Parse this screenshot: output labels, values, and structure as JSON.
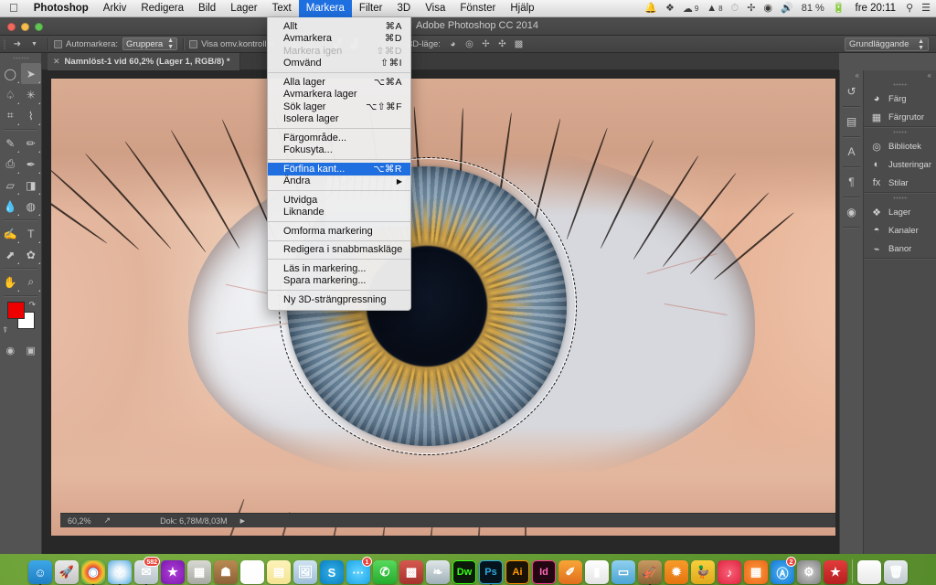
{
  "menubar": {
    "apple_icon": "apple-logo",
    "items": [
      {
        "label": "Photoshop",
        "bold": true,
        "active": false
      },
      {
        "label": "Arkiv",
        "bold": false,
        "active": false
      },
      {
        "label": "Redigera",
        "bold": false,
        "active": false
      },
      {
        "label": "Bild",
        "bold": false,
        "active": false
      },
      {
        "label": "Lager",
        "bold": false,
        "active": false
      },
      {
        "label": "Text",
        "bold": false,
        "active": false
      },
      {
        "label": "Markera",
        "bold": false,
        "active": true
      },
      {
        "label": "Filter",
        "bold": false,
        "active": false
      },
      {
        "label": "3D",
        "bold": false,
        "active": false
      },
      {
        "label": "Visa",
        "bold": false,
        "active": false
      },
      {
        "label": "Fönster",
        "bold": false,
        "active": false
      },
      {
        "label": "Hjälp",
        "bold": false,
        "active": false
      }
    ],
    "status": {
      "bell_icon": "bell-icon",
      "dropbox_icon": "dropbox-icon",
      "cc_icon": "creative-cloud-icon",
      "cc_badge": "9",
      "adobe_icon": "adobe-icon",
      "adobe_badge": "8",
      "clock_icon": "time-machine-icon",
      "vpn_icon": "vpn-icon",
      "wifi_icon": "wifi-icon",
      "volume_icon": "volume-icon",
      "battery_percent": "81 %",
      "battery_icon": "battery-icon",
      "clock": "fre 20:11",
      "search_icon": "spotlight-search-icon",
      "notification_icon": "notification-center-icon"
    }
  },
  "app": {
    "title": "Adobe Photoshop CC 2014",
    "window_controls": {
      "close": "close",
      "minimize": "minimize",
      "zoom": "zoom"
    }
  },
  "options_bar": {
    "move_tool_icon": "move-tool-icon",
    "preset_arrow": "chevron-down-icon",
    "auto_select_label": "Automarkera:",
    "auto_select_value": "Gruppera",
    "show_controls_label": "Visa omv.kontroller",
    "align_icons": [
      "align-left-edges",
      "align-horizontal-centers",
      "align-right-edges",
      "align-top-edges",
      "align-vertical-centers",
      "align-bottom-edges",
      "distribute-icon"
    ],
    "mode3d_label": "3D-läge:",
    "mode3d_icons": [
      "orbit-3d-icon",
      "roll-3d-icon",
      "pan-3d-icon",
      "slide-3d-icon",
      "zoom-3d-icon"
    ],
    "workspace": "Grundläggande"
  },
  "toolbox": {
    "tools": [
      {
        "row": [
          {
            "name": "elliptical-marquee-tool",
            "glyph": "◯",
            "selected": false
          },
          {
            "name": "move-tool",
            "glyph": "➤",
            "selected": true
          }
        ]
      },
      {
        "row": [
          {
            "name": "lasso-tool",
            "glyph": "♤",
            "selected": false
          },
          {
            "name": "magic-wand-tool",
            "glyph": "✳",
            "selected": false
          }
        ]
      },
      {
        "row": [
          {
            "name": "crop-tool",
            "glyph": "⌗",
            "selected": false
          },
          {
            "name": "eyedropper-tool",
            "glyph": "⌇",
            "selected": false
          }
        ]
      },
      {
        "row": [
          {
            "name": "spot-healing-brush-tool",
            "glyph": "✎",
            "selected": false
          },
          {
            "name": "brush-tool",
            "glyph": "✏",
            "selected": false
          }
        ]
      },
      {
        "row": [
          {
            "name": "clone-stamp-tool",
            "glyph": "⎙",
            "selected": false
          },
          {
            "name": "history-brush-tool",
            "glyph": "✒",
            "selected": false
          }
        ]
      },
      {
        "row": [
          {
            "name": "eraser-tool",
            "glyph": "▱",
            "selected": false
          },
          {
            "name": "gradient-tool",
            "glyph": "◨",
            "selected": false
          }
        ]
      },
      {
        "row": [
          {
            "name": "blur-tool",
            "glyph": "💧",
            "selected": false
          },
          {
            "name": "dodge-tool",
            "glyph": "◍",
            "selected": false
          }
        ]
      },
      {
        "row": [
          {
            "name": "pen-tool",
            "glyph": "✍",
            "selected": false
          },
          {
            "name": "type-tool",
            "glyph": "T",
            "selected": false
          }
        ]
      },
      {
        "row": [
          {
            "name": "path-selection-tool",
            "glyph": "⬈",
            "selected": false
          },
          {
            "name": "custom-shape-tool",
            "glyph": "✿",
            "selected": false
          }
        ]
      },
      {
        "row": [
          {
            "name": "hand-tool",
            "glyph": "✋",
            "selected": false
          },
          {
            "name": "zoom-tool",
            "glyph": "⌕",
            "selected": false
          }
        ]
      }
    ],
    "foreground_color": "#ee0000",
    "background_color": "#ffffff",
    "swap_icon": "swap-colors-icon",
    "default_colors_icon": "default-colors-icon",
    "quick_mask_icon": "quick-mask-icon",
    "screen_mode_icon": "screen-mode-icon"
  },
  "document": {
    "tab_title": "Namnlöst-1 vid 60,2% (Lager 1, RGB/8) *",
    "tab_close_icon": "close-icon",
    "status_zoom": "60,2%",
    "status_share_icon": "share-icon",
    "status_doc": "Dok: 6,78M/8,03M",
    "status_arrow_icon": "chevron-right-icon"
  },
  "rail": {
    "collapse_icon": "collapse-panels-icon",
    "buttons": [
      {
        "name": "history-panel-icon",
        "glyph": "↺"
      },
      {
        "name": "properties-panel-icon",
        "glyph": "▤"
      },
      {
        "name": "character-panel-icon",
        "glyph": "A"
      },
      {
        "name": "paragraph-panel-icon",
        "glyph": "¶"
      },
      {
        "name": "color-wheel-panel-icon",
        "glyph": "◉"
      }
    ]
  },
  "panels": {
    "collapse_icon": "collapse-panels-icon",
    "groups": [
      {
        "rows": [
          {
            "label": "Färg",
            "icon": "color-palette-icon",
            "glyph": "◕"
          },
          {
            "label": "Färgrutor",
            "icon": "swatches-icon",
            "glyph": "▦"
          }
        ]
      },
      {
        "rows": [
          {
            "label": "Bibliotek",
            "icon": "libraries-icon",
            "glyph": "◎"
          },
          {
            "label": "Justeringar",
            "icon": "adjustments-icon",
            "glyph": "◐"
          },
          {
            "label": "Stilar",
            "icon": "styles-icon",
            "glyph": "fx"
          }
        ]
      },
      {
        "rows": [
          {
            "label": "Lager",
            "icon": "layers-icon",
            "glyph": "❖"
          },
          {
            "label": "Kanaler",
            "icon": "channels-icon",
            "glyph": "◓"
          },
          {
            "label": "Banor",
            "icon": "paths-icon",
            "glyph": "⌁"
          }
        ]
      }
    ]
  },
  "dropdown": {
    "owner": "Markera",
    "sections": [
      {
        "items": [
          {
            "label": "Allt",
            "shortcut": "⌘A",
            "disabled": false,
            "highlighted": false,
            "submenu": false
          },
          {
            "label": "Avmarkera",
            "shortcut": "⌘D",
            "disabled": false,
            "highlighted": false,
            "submenu": false
          },
          {
            "label": "Markera igen",
            "shortcut": "⇧⌘D",
            "disabled": true,
            "highlighted": false,
            "submenu": false
          },
          {
            "label": "Omvänd",
            "shortcut": "⇧⌘I",
            "disabled": false,
            "highlighted": false,
            "submenu": false
          }
        ]
      },
      {
        "items": [
          {
            "label": "Alla lager",
            "shortcut": "⌥⌘A",
            "disabled": false,
            "highlighted": false,
            "submenu": false
          },
          {
            "label": "Avmarkera lager",
            "shortcut": "",
            "disabled": false,
            "highlighted": false,
            "submenu": false
          },
          {
            "label": "Sök lager",
            "shortcut": "⌥⇧⌘F",
            "disabled": false,
            "highlighted": false,
            "submenu": false
          },
          {
            "label": "Isolera lager",
            "shortcut": "",
            "disabled": false,
            "highlighted": false,
            "submenu": false
          }
        ]
      },
      {
        "items": [
          {
            "label": "Färgområde...",
            "shortcut": "",
            "disabled": false,
            "highlighted": false,
            "submenu": false
          },
          {
            "label": "Fokusyta...",
            "shortcut": "",
            "disabled": false,
            "highlighted": false,
            "submenu": false
          }
        ]
      },
      {
        "items": [
          {
            "label": "Förfina kant...",
            "shortcut": "⌥⌘R",
            "disabled": false,
            "highlighted": true,
            "submenu": false
          },
          {
            "label": "Ändra",
            "shortcut": "",
            "disabled": false,
            "highlighted": false,
            "submenu": true
          }
        ]
      },
      {
        "items": [
          {
            "label": "Utvidga",
            "shortcut": "",
            "disabled": false,
            "highlighted": false,
            "submenu": false
          },
          {
            "label": "Liknande",
            "shortcut": "",
            "disabled": false,
            "highlighted": false,
            "submenu": false
          }
        ]
      },
      {
        "items": [
          {
            "label": "Omforma markering",
            "shortcut": "",
            "disabled": false,
            "highlighted": false,
            "submenu": false
          }
        ]
      },
      {
        "items": [
          {
            "label": "Redigera i snabbmaskläge",
            "shortcut": "",
            "disabled": false,
            "highlighted": false,
            "submenu": false
          }
        ]
      },
      {
        "items": [
          {
            "label": "Läs in markering...",
            "shortcut": "",
            "disabled": false,
            "highlighted": false,
            "submenu": false
          },
          {
            "label": "Spara markering...",
            "shortcut": "",
            "disabled": false,
            "highlighted": false,
            "submenu": false
          }
        ]
      },
      {
        "items": [
          {
            "label": "Ny 3D-strängpressning",
            "shortcut": "",
            "disabled": false,
            "highlighted": false,
            "submenu": false
          }
        ]
      }
    ]
  },
  "dock": {
    "items": [
      {
        "name": "finder",
        "glyph": "☺",
        "bg": "linear-gradient(180deg,#3da7e8,#1f7fc4)",
        "running": true,
        "badge": ""
      },
      {
        "name": "launchpad",
        "glyph": "🚀",
        "bg": "linear-gradient(180deg,#e9e9e9,#c4c4c4)",
        "running": false,
        "badge": ""
      },
      {
        "name": "google-chrome",
        "glyph": "◉",
        "bg": "radial-gradient(circle at 50% 50%,#2b87e0 28%,#e94335 29%,#f6c22d 60%,#33a852 90%)",
        "running": true,
        "badge": ""
      },
      {
        "name": "safari",
        "glyph": "✧",
        "bg": "radial-gradient(circle,#eaf4fb 30%,#4fa8e0 100%)",
        "running": true,
        "badge": ""
      },
      {
        "name": "mail",
        "glyph": "✉",
        "bg": "linear-gradient(180deg,#dfe6ea,#b8c3ca)",
        "running": true,
        "badge": "582"
      },
      {
        "name": "imovie",
        "glyph": "★",
        "bg": "radial-gradient(circle,#b040d8,#7a16ad)",
        "running": false,
        "badge": ""
      },
      {
        "name": "calculator",
        "glyph": "▦",
        "bg": "linear-gradient(180deg,#d8d8d4,#a9a9a4)",
        "running": false,
        "badge": ""
      },
      {
        "name": "contacts",
        "glyph": "☗",
        "bg": "linear-gradient(180deg,#b98a52,#8d6236)",
        "running": false,
        "badge": ""
      },
      {
        "name": "calendar",
        "glyph": "2",
        "bg": "linear-gradient(180deg,#ffffff 0 34%,#fdfdfd 34%)",
        "running": false,
        "badge": ""
      },
      {
        "name": "notes",
        "glyph": "▤",
        "bg": "linear-gradient(180deg,#fdf3b9,#f3e392)",
        "running": false,
        "badge": ""
      },
      {
        "name": "preview",
        "glyph": "🖼",
        "bg": "linear-gradient(180deg,#cfe3f2,#9ebed6)",
        "running": false,
        "badge": ""
      },
      {
        "name": "skype",
        "glyph": "S",
        "bg": "radial-gradient(circle,#33b0e8,#0a7ec0)",
        "running": false,
        "badge": ""
      },
      {
        "name": "messages",
        "glyph": "···",
        "bg": "radial-gradient(circle,#63d4ff,#1ba4e8)",
        "running": false,
        "badge": "1"
      },
      {
        "name": "facetime",
        "glyph": "✆",
        "bg": "linear-gradient(180deg,#57d95c,#24ab2e)",
        "running": false,
        "badge": ""
      },
      {
        "name": "photo-booth",
        "glyph": "▩",
        "bg": "linear-gradient(180deg,#d6584f,#a5322c)",
        "running": false,
        "badge": ""
      },
      {
        "name": "iphoto",
        "glyph": "❧",
        "bg": "linear-gradient(180deg,#dfe6e9,#9fb0b8)",
        "running": false,
        "badge": ""
      },
      {
        "name": "dreamweaver",
        "glyph": "Dw",
        "bg": "#0b1a0b",
        "running": false,
        "badge": ""
      },
      {
        "name": "photoshop",
        "glyph": "Ps",
        "bg": "#05131c",
        "running": true,
        "badge": ""
      },
      {
        "name": "illustrator",
        "glyph": "Ai",
        "bg": "#1b1206",
        "running": false,
        "badge": ""
      },
      {
        "name": "indesign",
        "glyph": "Id",
        "bg": "#220713",
        "running": false,
        "badge": ""
      },
      {
        "name": "pages",
        "glyph": "✐",
        "bg": "linear-gradient(180deg,#f7a536,#e06f1e)",
        "running": false,
        "badge": ""
      },
      {
        "name": "numbers",
        "glyph": "▮",
        "bg": "linear-gradient(180deg,#ffffff,#e4e4e4)",
        "running": false,
        "badge": ""
      },
      {
        "name": "keynote",
        "glyph": "▭",
        "bg": "linear-gradient(180deg,#8fd0ef,#4ba4d4)",
        "running": false,
        "badge": ""
      },
      {
        "name": "garageband",
        "glyph": "🎻",
        "bg": "linear-gradient(180deg,#c89a62,#8a6334)",
        "running": true,
        "badge": ""
      },
      {
        "name": "avast",
        "glyph": "✹",
        "bg": "linear-gradient(180deg,#f79b2a,#e4740f)",
        "running": false,
        "badge": ""
      },
      {
        "name": "duck",
        "glyph": "🦆",
        "bg": "linear-gradient(180deg,#f8cf3d,#e0a81b)",
        "running": false,
        "badge": ""
      },
      {
        "name": "itunes",
        "glyph": "♪",
        "bg": "radial-gradient(circle,#f86379,#e0213f)",
        "running": false,
        "badge": ""
      },
      {
        "name": "ibooks",
        "glyph": "▦",
        "bg": "radial-gradient(circle,#ff9a3c,#e9661a)",
        "running": false,
        "badge": ""
      },
      {
        "name": "app-store",
        "glyph": "Ⓐ",
        "bg": "radial-gradient(circle,#4fb3f0,#1277d6)",
        "running": false,
        "badge": "2"
      },
      {
        "name": "system-preferences",
        "glyph": "⚙",
        "bg": "radial-gradient(circle,#cfcfcf,#7d7d7d)",
        "running": false,
        "badge": ""
      },
      {
        "name": "wunderlist",
        "glyph": "★",
        "bg": "linear-gradient(180deg,#e33b3b,#b51f1f)",
        "running": false,
        "badge": ""
      },
      {
        "name": "document-stack",
        "glyph": "",
        "bg": "linear-gradient(180deg,#ffffff,#e8e8e8)",
        "running": false,
        "badge": ""
      },
      {
        "name": "trash",
        "glyph": "🗑",
        "bg": "linear-gradient(180deg,#e7ecef,#bfc8cd)",
        "running": false,
        "badge": ""
      }
    ]
  }
}
